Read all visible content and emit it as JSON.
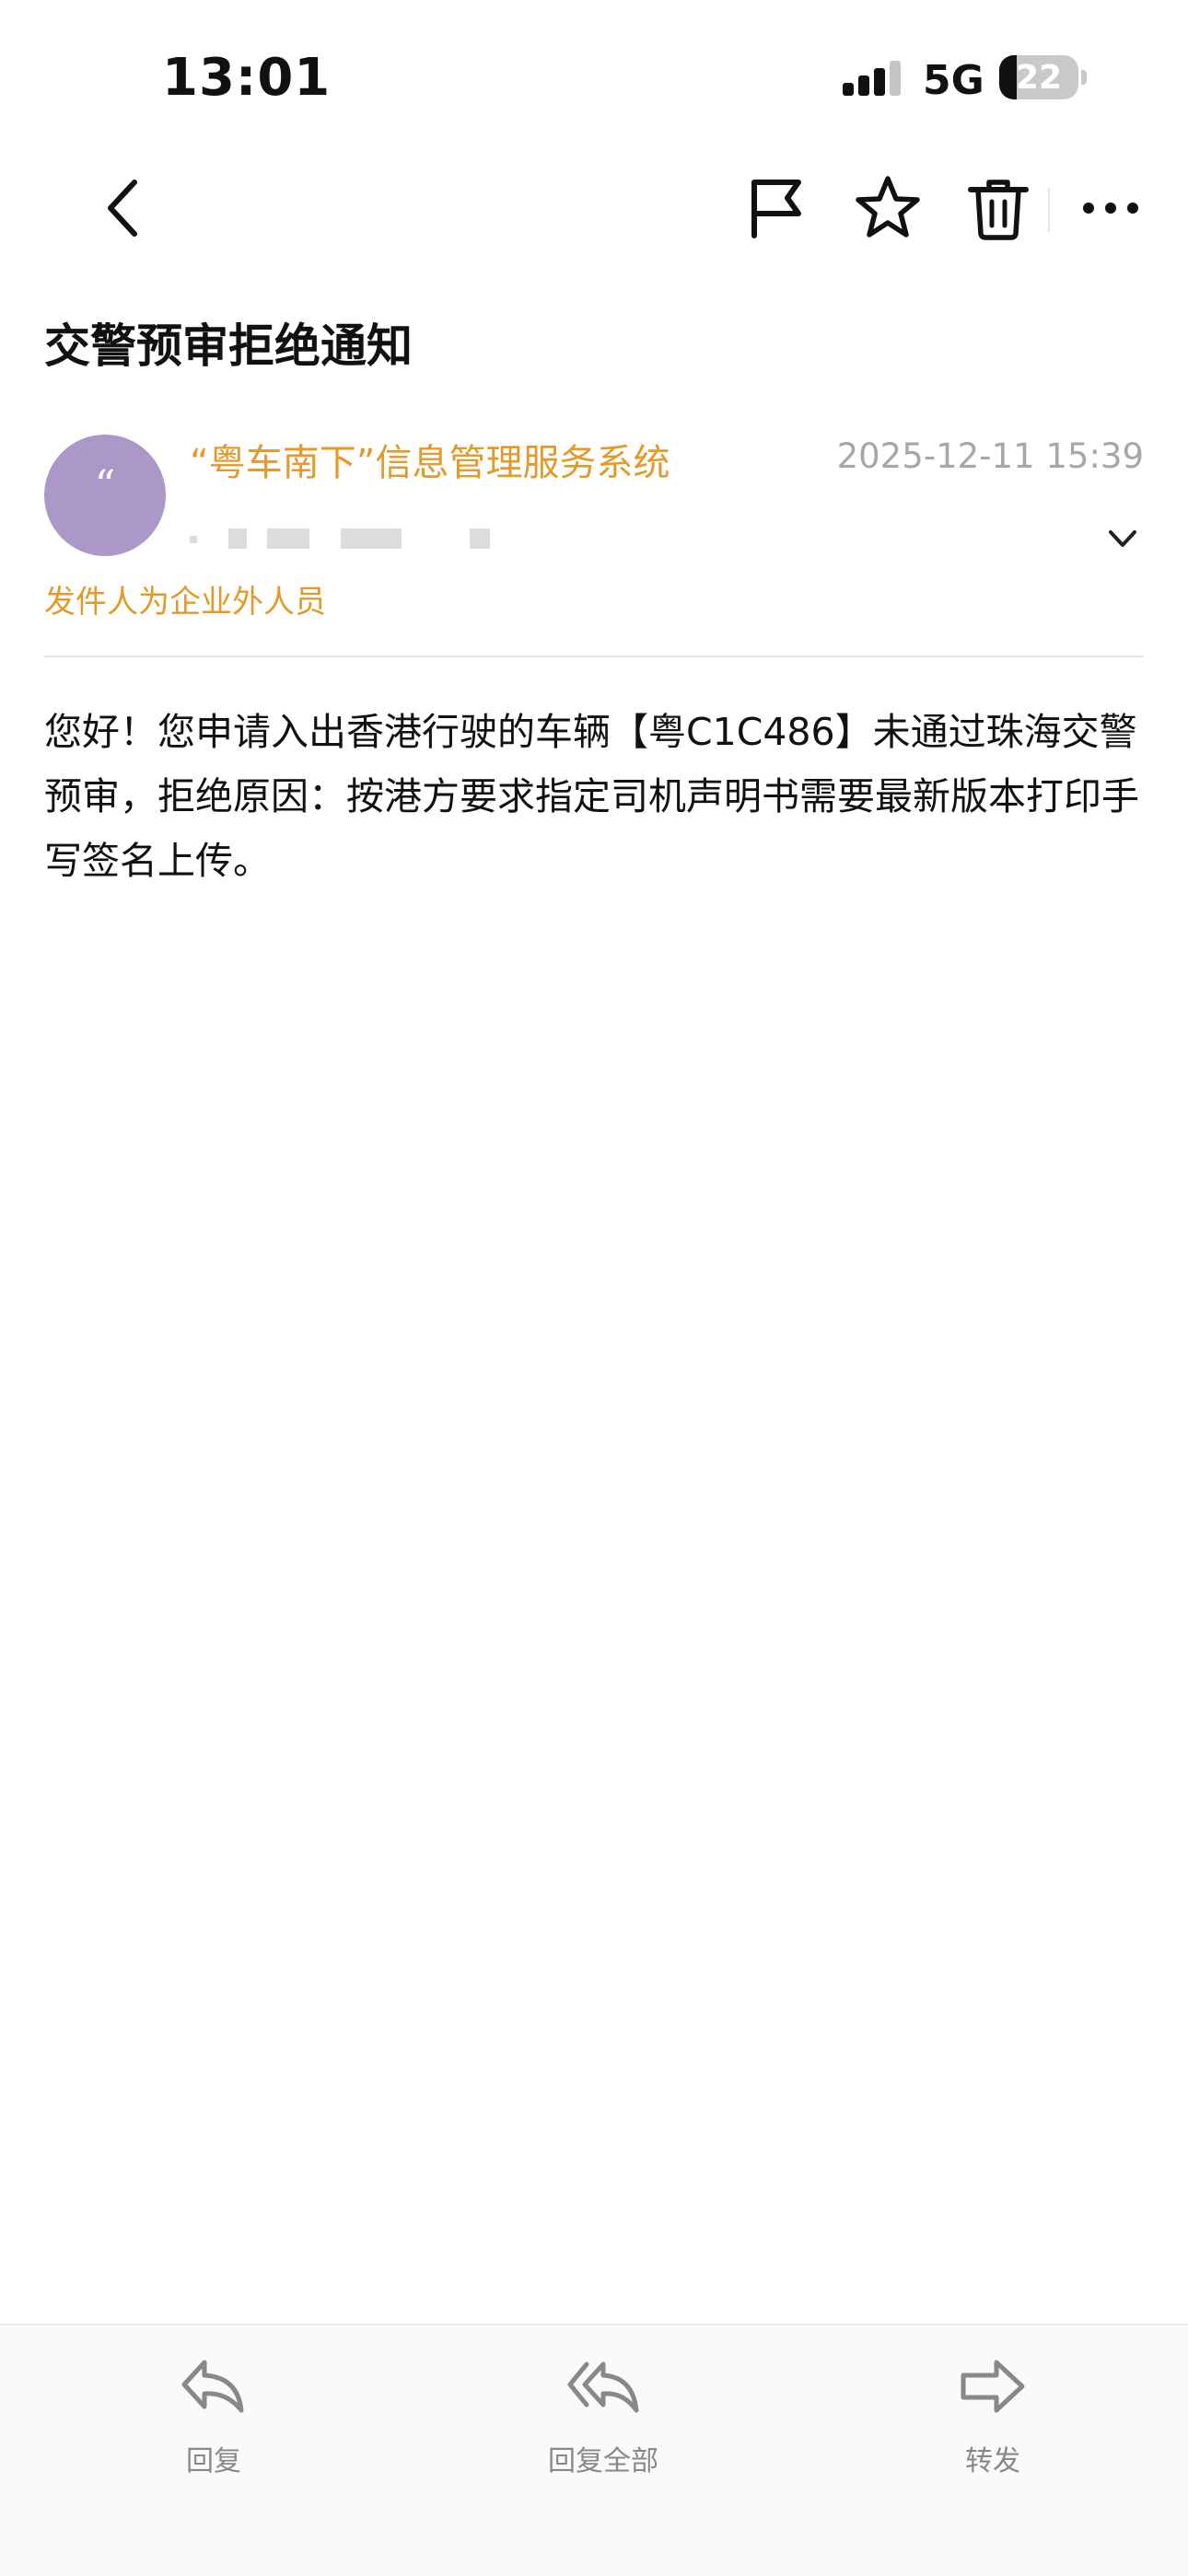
{
  "status_bar": {
    "time": "13:01",
    "network": "5G",
    "battery": "22",
    "battery_level": 0.22
  },
  "toolbar": {
    "back_icon": "chevron-left-icon",
    "flag_icon": "flag-icon",
    "star_icon": "star-icon",
    "delete_icon": "trash-icon",
    "more_icon": "more-horizontal-icon"
  },
  "email": {
    "subject": "交警预审拒绝通知",
    "sender": {
      "avatar_text": "“",
      "avatar_color": "#ab98c8",
      "name": "“粤车南下”信息管理服务系统",
      "name_color": "#e39a2a",
      "external_notice": "发件人为企业外人员"
    },
    "date": "2025-12-11 15:39",
    "body": "您好！您申请入出香港行驶的车辆【粤C1C486】未通过珠海交警预审，拒绝原因：按港方要求指定司机声明书需要最新版本打印手写签名上传。"
  },
  "bottom_actions": [
    {
      "label": "回复",
      "icon": "reply-icon"
    },
    {
      "label": "回复全部",
      "icon": "reply-all-icon"
    },
    {
      "label": "转发",
      "icon": "forward-icon"
    }
  ]
}
